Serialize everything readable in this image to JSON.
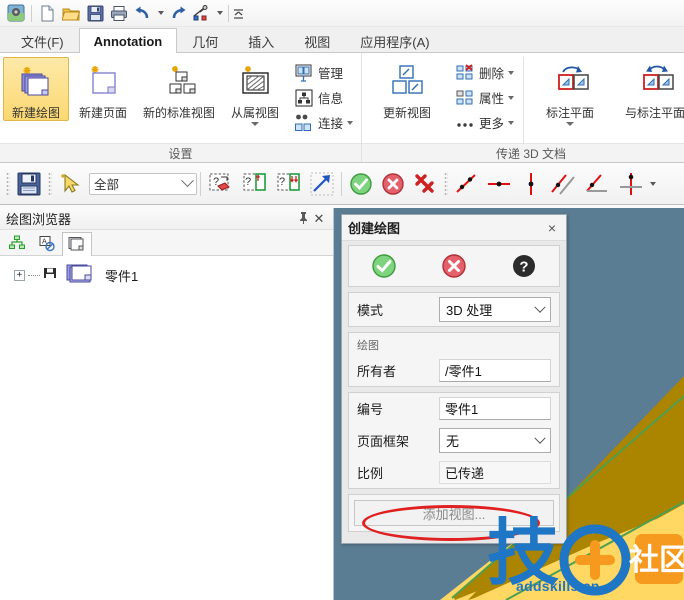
{
  "quick_access": {
    "items": [
      {
        "name": "app-menu-icon",
        "label": "应用程序菜单"
      },
      {
        "name": "new-file-icon",
        "label": "新建"
      },
      {
        "name": "open-folder-icon",
        "label": "打开"
      },
      {
        "name": "save-icon",
        "label": "保存"
      },
      {
        "name": "print-icon",
        "label": "打印"
      },
      {
        "name": "undo-icon",
        "label": "撤销"
      },
      {
        "name": "redo-icon",
        "label": "重做"
      },
      {
        "name": "tools-icon",
        "label": "工具"
      },
      {
        "name": "customize-icon",
        "label": "自定义"
      }
    ]
  },
  "ribbon": {
    "tabs": [
      {
        "label": "文件(F)",
        "active": false
      },
      {
        "label": "Annotation",
        "active": true
      },
      {
        "label": "几何",
        "active": false
      },
      {
        "label": "插入",
        "active": false
      },
      {
        "label": "视图",
        "active": false
      },
      {
        "label": "应用程序(A)",
        "active": false
      }
    ],
    "groups": [
      {
        "title": "设置",
        "big_buttons": [
          {
            "label": "新建绘图",
            "icon": "new-drawing-icon",
            "selected": true
          },
          {
            "label": "新建页面",
            "icon": "new-page-icon",
            "selected": false
          },
          {
            "label": "新的标准视图",
            "icon": "new-standard-view-icon",
            "selected": false
          },
          {
            "label": "从属视图",
            "icon": "dependent-view-icon",
            "selected": false,
            "has_caret": true
          }
        ],
        "small_buttons": [
          {
            "label": "管理",
            "icon": "manage-icon",
            "has_caret": false
          },
          {
            "label": "信息",
            "icon": "info-icon",
            "has_caret": false
          },
          {
            "label": "连接",
            "icon": "connect-icon",
            "has_caret": true
          }
        ]
      },
      {
        "title": "传递 3D 文档",
        "big_buttons": [
          {
            "label": "更新视图",
            "icon": "update-view-icon",
            "selected": false
          }
        ],
        "small_buttons": [
          {
            "label": "删除",
            "icon": "delete-icon",
            "has_caret": true
          },
          {
            "label": "属性",
            "icon": "properties-icon",
            "has_caret": true
          },
          {
            "label": "更多",
            "icon": "more-icon",
            "has_caret": true
          }
        ],
        "big_buttons_2": [
          {
            "label": "标注平面",
            "icon": "annotation-plane-icon",
            "selected": false,
            "has_caret": true
          },
          {
            "label": "与标注平面",
            "icon": "with-annotation-plane-icon",
            "selected": false
          }
        ]
      }
    ]
  },
  "toolbar2": {
    "save_icon": "save-icon",
    "pointer_icon": "select-pointer-icon",
    "filter_combo": {
      "value": "全部",
      "placeholder": "全部"
    },
    "buttons": [
      {
        "name": "erase-annotation-icon"
      },
      {
        "name": "create-annotation-icon"
      },
      {
        "name": "edit-annotation-icon"
      },
      {
        "name": "move-annotation-icon"
      },
      {
        "name": "accept-icon"
      },
      {
        "name": "cancel-icon"
      },
      {
        "name": "delete-all-icon"
      },
      {
        "name": "dim-oblique-icon"
      },
      {
        "name": "dim-horizontal-icon"
      },
      {
        "name": "dim-vertical-icon"
      },
      {
        "name": "dim-parallel-icon"
      },
      {
        "name": "dim-angle-icon"
      },
      {
        "name": "dim-perpendicular-icon"
      }
    ]
  },
  "browser_panel": {
    "title": "绘图浏览器",
    "pin_icon": "pin-icon",
    "close_icon": "close-icon",
    "tabs": [
      {
        "name": "assembly-tree-tab",
        "active": false
      },
      {
        "name": "annotation-filter-tab",
        "active": false
      },
      {
        "name": "drawing-tab",
        "active": true
      }
    ],
    "tree": [
      {
        "label": "零件1",
        "expander": "+",
        "icon": "drawing-stack-icon"
      }
    ]
  },
  "dialog": {
    "title": "创建绘图",
    "close_label": "×",
    "actions": [
      {
        "name": "ok-icon",
        "label": "确定"
      },
      {
        "name": "cancel-icon",
        "label": "取消"
      },
      {
        "name": "help-icon",
        "label": "帮助"
      }
    ],
    "mode_label": "模式",
    "mode_value": "3D 处理",
    "group_drawing": "绘图",
    "owner_label": "所有者",
    "owner_value": "/零件1",
    "number_label": "编号",
    "number_value": "零件1",
    "frame_label": "页面框架",
    "frame_value": "无",
    "scale_label": "比例",
    "scale_value": "已传递",
    "add_view_button": "添加视图..."
  },
  "watermark": {
    "mark_text": "技",
    "badge_text": "社区",
    "url": "addskills.cn"
  },
  "colors": {
    "viewport_bg": "#5b7d93",
    "viewport_gold": "#ab8400",
    "viewport_yellow": "#ffd864",
    "accent_selected": "#fcd872",
    "annotation_red": "#e02020",
    "watermark_blue": "#1f76c4",
    "watermark_orange": "#f59a1e"
  }
}
